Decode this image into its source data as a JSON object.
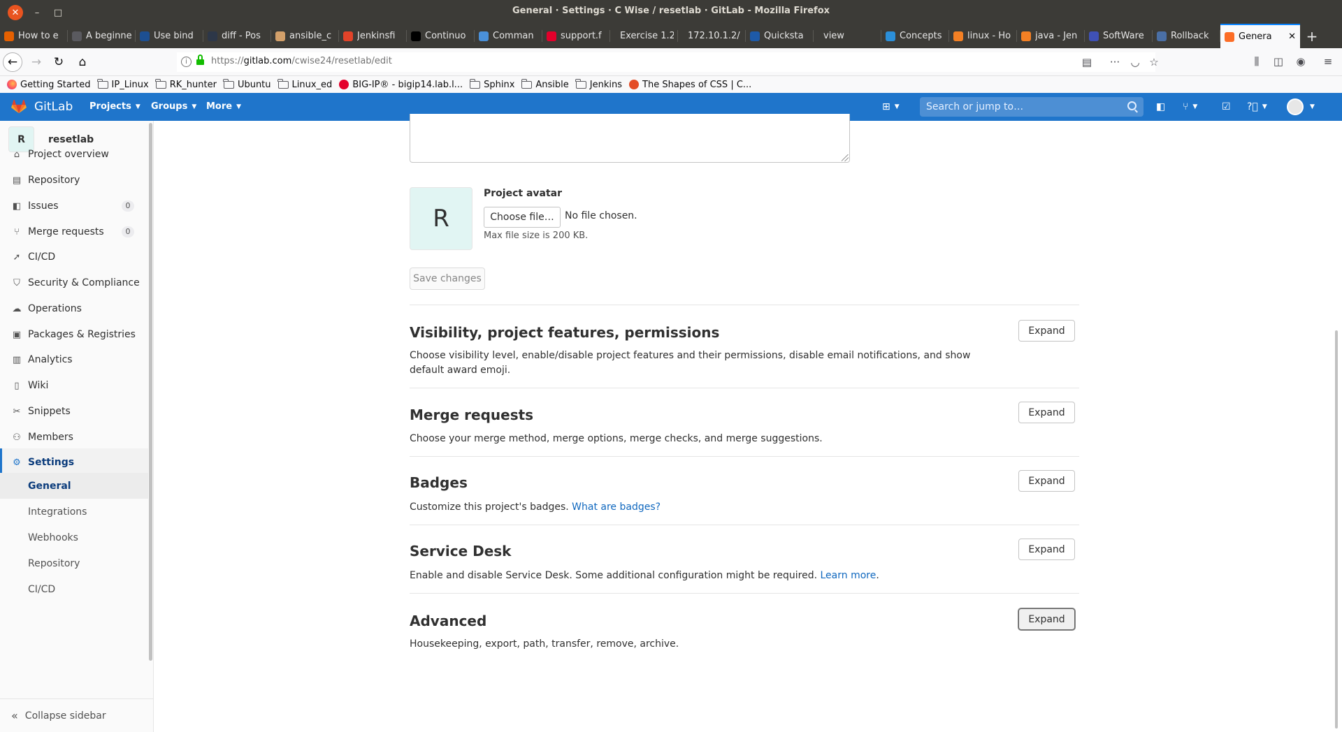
{
  "window": {
    "title": "General · Settings · C Wise / resetlab · GitLab - Mozilla Firefox"
  },
  "tabs": [
    {
      "label": "How to e",
      "color": "#e66000"
    },
    {
      "label": "A beginne",
      "color": "#5a5a5f"
    },
    {
      "label": "Use bind",
      "color": "#1d4f91"
    },
    {
      "label": "diff - Pos",
      "color": "#2d3748"
    },
    {
      "label": "ansible_c",
      "color": "#d3a06a"
    },
    {
      "label": "Jenkinsfi",
      "color": "#e24329"
    },
    {
      "label": "Continuo",
      "color": "#000000"
    },
    {
      "label": "Comman",
      "color": "#4a90d9"
    },
    {
      "label": "support.f",
      "color": "#e4002b"
    },
    {
      "label": "Exercise 1.2 -",
      "color": ""
    },
    {
      "label": "172.10.1.2/",
      "color": ""
    },
    {
      "label": "Quicksta",
      "color": "#1e5aa8"
    },
    {
      "label": "view",
      "color": ""
    },
    {
      "label": "Concepts",
      "color": "#2b8fd9"
    },
    {
      "label": "linux - Ho",
      "color": "#f48024"
    },
    {
      "label": "java - Jen",
      "color": "#f48024"
    },
    {
      "label": "SoftWare",
      "color": "#3f51b5"
    },
    {
      "label": "Rollback",
      "color": "#4a6fa5"
    }
  ],
  "active_tab": {
    "label": "Genera",
    "close": "✕"
  },
  "new_tab": "+",
  "address": {
    "prefix": "https://",
    "host": "gitlab.com",
    "path": "/cwise24/resetlab/edit"
  },
  "bookmarks": [
    {
      "label": "Getting Started",
      "icon": "firefox-icon",
      "type": "firefox"
    },
    {
      "label": "IP_Linux",
      "icon": "folder-icon",
      "type": "folder"
    },
    {
      "label": "RK_hunter",
      "icon": "folder-icon",
      "type": "folder"
    },
    {
      "label": "Ubuntu",
      "icon": "folder-icon",
      "type": "folder"
    },
    {
      "label": "Linux_ed",
      "icon": "folder-icon",
      "type": "folder"
    },
    {
      "label": "BIG-IP® - bigip14.lab.l...",
      "icon": "f5-icon",
      "type": "f5"
    },
    {
      "label": "Sphinx",
      "icon": "folder-icon",
      "type": "folder"
    },
    {
      "label": "Ansible",
      "icon": "folder-icon",
      "type": "folder"
    },
    {
      "label": "Jenkins",
      "icon": "folder-icon",
      "type": "folder"
    },
    {
      "label": "The Shapes of CSS | C...",
      "icon": "css-icon",
      "type": "css"
    }
  ],
  "gitlab_header": {
    "brand": "GitLab",
    "nav": [
      "Projects",
      "Groups",
      "More"
    ],
    "search_placeholder": "Search or jump to…"
  },
  "sidebar": {
    "project_initial": "R",
    "project_name": "resetlab",
    "items": [
      {
        "label": "Project overview",
        "icon": "home-icon",
        "glyph": "⌂",
        "badge": null
      },
      {
        "label": "Repository",
        "icon": "book-icon",
        "glyph": "▤",
        "badge": null
      },
      {
        "label": "Issues",
        "icon": "issues-icon",
        "glyph": "◧",
        "badge": "0"
      },
      {
        "label": "Merge requests",
        "icon": "merge-request-icon",
        "glyph": "⑂",
        "badge": "0"
      },
      {
        "label": "CI/CD",
        "icon": "rocket-icon",
        "glyph": "➚",
        "badge": null
      },
      {
        "label": "Security & Compliance",
        "icon": "shield-icon",
        "glyph": "⛉",
        "badge": null
      },
      {
        "label": "Operations",
        "icon": "cloud-gear-icon",
        "glyph": "☁",
        "badge": null
      },
      {
        "label": "Packages & Registries",
        "icon": "package-icon",
        "glyph": "▣",
        "badge": null
      },
      {
        "label": "Analytics",
        "icon": "chart-icon",
        "glyph": "▥",
        "badge": null
      },
      {
        "label": "Wiki",
        "icon": "wiki-icon",
        "glyph": "▯",
        "badge": null
      },
      {
        "label": "Snippets",
        "icon": "scissors-icon",
        "glyph": "✂",
        "badge": null
      },
      {
        "label": "Members",
        "icon": "users-icon",
        "glyph": "⚇",
        "badge": null
      },
      {
        "label": "Settings",
        "icon": "gear-icon",
        "glyph": "⚙",
        "badge": null
      }
    ],
    "sub_items": [
      "General",
      "Integrations",
      "Webhooks",
      "Repository",
      "CI/CD"
    ],
    "collapse_label": "Collapse sidebar"
  },
  "content": {
    "avatar_initial": "R",
    "avatar_label": "Project avatar",
    "file_button": "Choose file…",
    "file_status": "No file chosen.",
    "file_help": "Max file size is 200 KB.",
    "save_button": "Save changes",
    "expand_label": "Expand",
    "sections": [
      {
        "title": "Visibility, project features, permissions",
        "desc": "Choose visibility level, enable/disable project features and their permissions, disable email notifications, and show default award emoji.",
        "link": ""
      },
      {
        "title": "Merge requests",
        "desc": "Choose your merge method, merge options, merge checks, and merge suggestions.",
        "link": ""
      },
      {
        "title": "Badges",
        "desc": "Customize this project's badges.",
        "link": "What are badges?"
      },
      {
        "title": "Service Desk",
        "desc": "Enable and disable Service Desk. Some additional configuration might be required.",
        "link": "Learn more"
      },
      {
        "title": "Advanced",
        "desc": "Housekeeping, export, path, transfer, remove, archive.",
        "link": ""
      }
    ]
  },
  "colors": {
    "gitlab_header": "#1f75cb",
    "link": "#1068bf",
    "sidebar_active": "#0b3c7c"
  }
}
